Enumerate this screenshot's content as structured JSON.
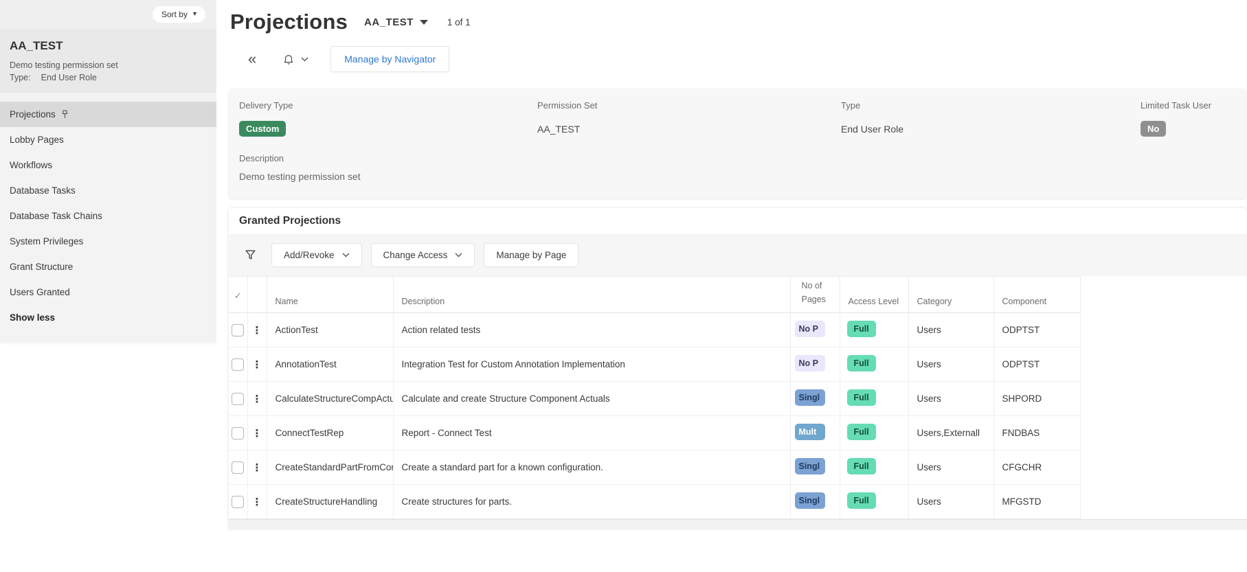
{
  "icons": {
    "caret_down": "▾",
    "collapse_left": "«",
    "kebab": "⋮",
    "select_all_check": "✓"
  },
  "sidebar": {
    "sort_by_label": "Sort by",
    "profile": {
      "title": "AA_TEST",
      "description": "Demo testing permission set",
      "type_label": "Type:",
      "type_value": "End User Role"
    },
    "items": [
      {
        "label": "Projections"
      },
      {
        "label": "Lobby Pages"
      },
      {
        "label": "Workflows"
      },
      {
        "label": "Database Tasks"
      },
      {
        "label": "Database Task Chains"
      },
      {
        "label": "System Privileges"
      },
      {
        "label": "Grant Structure"
      },
      {
        "label": "Users Granted"
      },
      {
        "label": "Show less"
      }
    ]
  },
  "header": {
    "title": "Projections",
    "selector_value": "AA_TEST",
    "record_count": "1 of 1",
    "manage_by_navigator_label": "Manage by Navigator",
    "link_color": "#3178d2"
  },
  "details": {
    "fields": [
      {
        "label": "Delivery Type",
        "value": "Custom",
        "badge_bg": "#3a8a5e",
        "badge_fg": "#ffffff"
      },
      {
        "label": "Permission Set",
        "value": "AA_TEST"
      },
      {
        "label": "Type",
        "value": "End User Role"
      },
      {
        "label": "Limited Task User",
        "value": "No",
        "badge_bg": "#8f8f8f",
        "badge_fg": "#ffffff"
      }
    ],
    "description_label": "Description",
    "description_value": "Demo testing permission set"
  },
  "granted": {
    "title": "Granted Projections",
    "toolbar": {
      "add_revoke_label": "Add/Revoke",
      "change_access_label": "Change Access",
      "manage_by_page_label": "Manage by Page"
    },
    "table": {
      "columns": {
        "name": "Name",
        "description": "Description",
        "pages": "No of Pages",
        "access": "Access Level",
        "category": "Category",
        "component": "Component"
      },
      "rows": [
        {
          "name": "ActionTest",
          "description": "Action related tests",
          "pages": {
            "text": "No P",
            "bg": "#e9e7fb",
            "fg": "#3c3c5c"
          },
          "access": {
            "text": "Full",
            "bg": "#66dcb4",
            "fg": "#124e39"
          },
          "category": "Users",
          "component": "ODPTST"
        },
        {
          "name": "AnnotationTest",
          "description": "Integration Test for Custom Annotation Implementation",
          "pages": {
            "text": "No P",
            "bg": "#e9e7fb",
            "fg": "#3c3c5c"
          },
          "access": {
            "text": "Full",
            "bg": "#66dcb4",
            "fg": "#124e39"
          },
          "category": "Users",
          "component": "ODPTST"
        },
        {
          "name": "CalculateStructureCompActualsH",
          "description": "Calculate and create Structure Component Actuals",
          "pages": {
            "text": "Singl",
            "bg": "#7ba2d3",
            "fg": "#1d3a60"
          },
          "access": {
            "text": "Full",
            "bg": "#66dcb4",
            "fg": "#124e39"
          },
          "category": "Users",
          "component": "SHPORD"
        },
        {
          "name": "ConnectTestRep",
          "description": "Report - Connect Test",
          "pages": {
            "text": "Mult",
            "bg": "#70a7cd",
            "fg": "#ffffff"
          },
          "access": {
            "text": "Full",
            "bg": "#66dcb4",
            "fg": "#124e39"
          },
          "category": "Users,Externall",
          "component": "FNDBAS"
        },
        {
          "name": "CreateStandardPartFromConfigu",
          "description": "Create a standard part for a known configuration.",
          "pages": {
            "text": "Singl",
            "bg": "#7ba2d3",
            "fg": "#1d3a60"
          },
          "access": {
            "text": "Full",
            "bg": "#66dcb4",
            "fg": "#124e39"
          },
          "category": "Users",
          "component": "CFGCHR"
        },
        {
          "name": "CreateStructureHandling",
          "description": "Create structures for parts.",
          "pages": {
            "text": "Singl",
            "bg": "#7ba2d3",
            "fg": "#1d3a60"
          },
          "access": {
            "text": "Full",
            "bg": "#66dcb4",
            "fg": "#124e39"
          },
          "category": "Users",
          "component": "MFGSTD"
        }
      ]
    }
  }
}
